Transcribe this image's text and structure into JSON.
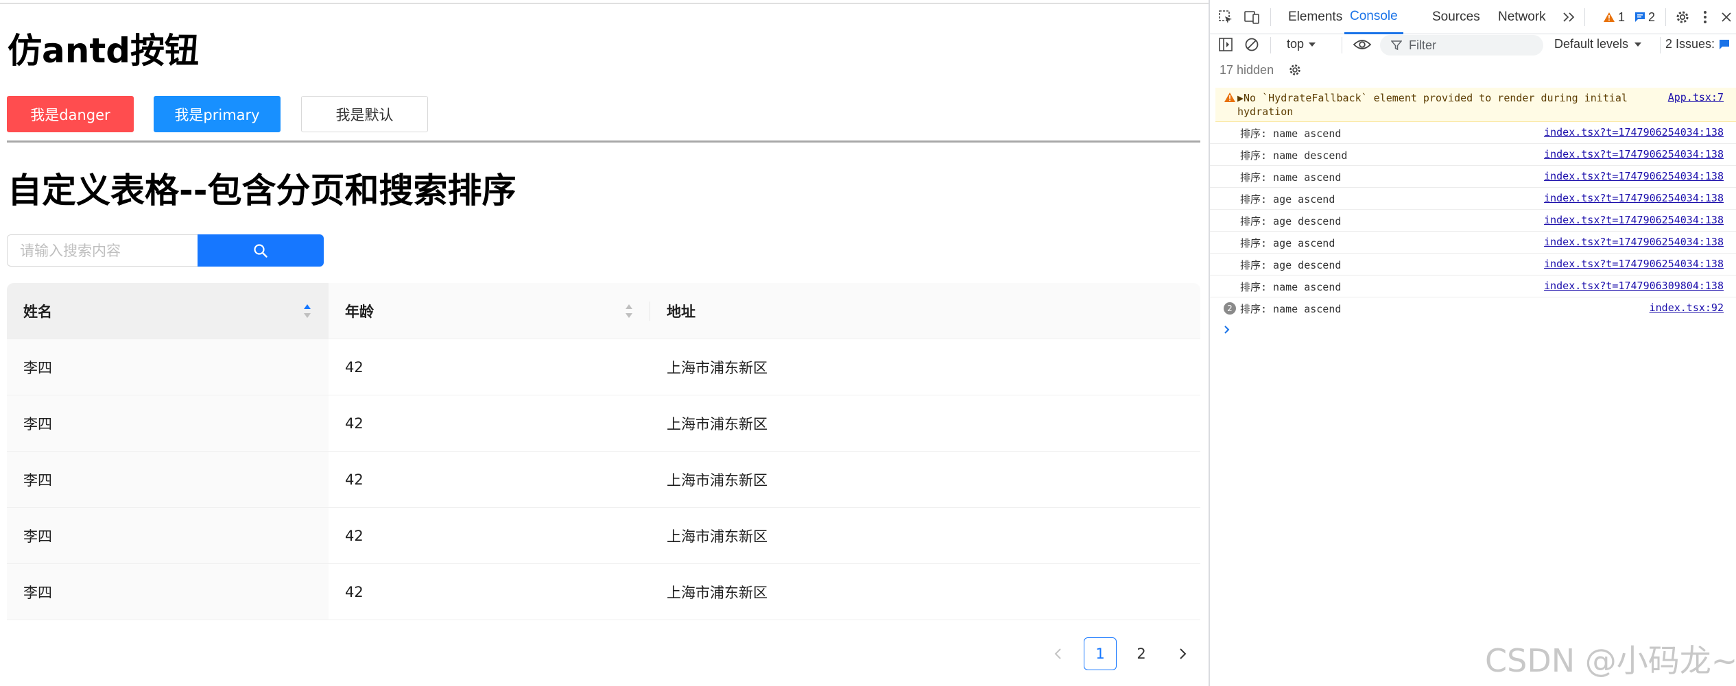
{
  "app": {
    "buttons_section_title": "仿antd按钮",
    "buttons": {
      "danger": "我是danger",
      "primary": "我是primary",
      "default": "我是默认"
    },
    "table_section_title": "自定义表格--包含分页和搜索排序",
    "search": {
      "placeholder": "请输入搜索内容",
      "value": ""
    },
    "table": {
      "columns": [
        "姓名",
        "年龄",
        "地址"
      ],
      "rows": [
        [
          "李四",
          "42",
          "上海市浦东新区"
        ],
        [
          "李四",
          "42",
          "上海市浦东新区"
        ],
        [
          "李四",
          "42",
          "上海市浦东新区"
        ],
        [
          "李四",
          "42",
          "上海市浦东新区"
        ],
        [
          "李四",
          "42",
          "上海市浦东新区"
        ]
      ]
    },
    "pagination": {
      "pages": [
        "1",
        "2"
      ],
      "current": "1"
    }
  },
  "devtools": {
    "tabs": [
      "Elements",
      "Console",
      "Sources",
      "Network"
    ],
    "active_tab": "Console",
    "warning_count": "1",
    "message_count": "2",
    "context": "top",
    "filter_placeholder": "Filter",
    "levels": "Default levels",
    "issues": "2 Issues:",
    "hidden": "17 hidden",
    "warning": {
      "message": "▶No `HydrateFallback` element provided to render during initial hydration",
      "source": "App.tsx:7"
    },
    "logs": [
      {
        "msg": "排序: name ascend",
        "src": "index.tsx?t=1747906254034:138"
      },
      {
        "msg": "排序: name descend",
        "src": "index.tsx?t=1747906254034:138"
      },
      {
        "msg": "排序: name ascend",
        "src": "index.tsx?t=1747906254034:138"
      },
      {
        "msg": "排序: age ascend",
        "src": "index.tsx?t=1747906254034:138"
      },
      {
        "msg": "排序: age descend",
        "src": "index.tsx?t=1747906254034:138"
      },
      {
        "msg": "排序: age ascend",
        "src": "index.tsx?t=1747906254034:138"
      },
      {
        "msg": "排序: age descend",
        "src": "index.tsx?t=1747906254034:138"
      },
      {
        "msg": "排序: name ascend",
        "src": "index.tsx?t=1747906309804:138"
      }
    ],
    "grouped_log": {
      "count": "2",
      "msg": "排序: name ascend",
      "src": "index.tsx:92"
    }
  },
  "watermark": "CSDN @小码龙~",
  "colors": {
    "danger": "#ff4d4f",
    "primary": "#1890ff",
    "search": "#1677ff",
    "devtools_accent": "#1a73e8"
  }
}
